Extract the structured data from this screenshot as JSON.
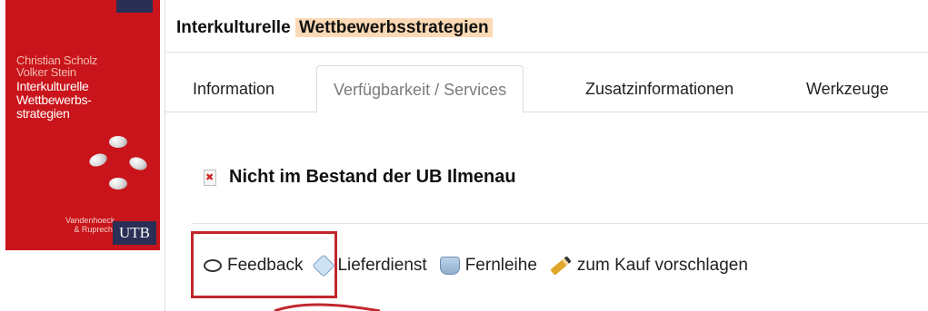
{
  "book_cover": {
    "authors": [
      "Christian Scholz",
      "Volker Stein"
    ],
    "title_lines": [
      "Interkulturelle",
      "Wettbewerbs-",
      "strategien"
    ],
    "publisher_lines": [
      "Vandenhoeck",
      "& Ruprecht"
    ],
    "series_logo": "UTB",
    "colors": {
      "background": "#c9141b",
      "accent": "#2a2f55"
    }
  },
  "header": {
    "title_plain": "Interkulturelle",
    "title_highlight": "Wettbewerbsstrategien",
    "highlight_color": "#fbd9b5"
  },
  "tabs": [
    {
      "label": "Information",
      "active": false
    },
    {
      "label": "Verfügbarkeit / Services",
      "active": true
    },
    {
      "label": "Zusatzinformationen",
      "active": false
    },
    {
      "label": "Werkzeuge",
      "active": false
    }
  ],
  "availability": {
    "icon": "unavailable-icon",
    "text": "Nicht im Bestand der UB Ilmenau"
  },
  "actions": [
    {
      "icon": "speech-bubble-icon",
      "label": "Feedback"
    },
    {
      "icon": "tag-icon",
      "label": "Lieferdienst"
    },
    {
      "icon": "hand-book-icon",
      "label": "Fernleihe"
    },
    {
      "icon": "pencil-icon",
      "label": "zum Kauf vorschlagen"
    }
  ],
  "annotation": {
    "color": "#c1272d",
    "target": "Feedback"
  }
}
